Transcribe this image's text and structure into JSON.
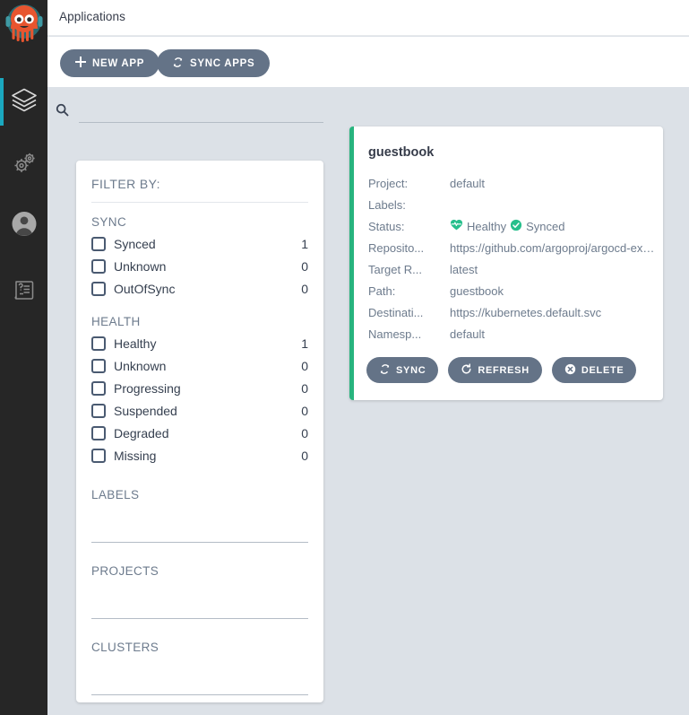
{
  "app": {
    "logo_icon": "argo-octopus-logo"
  },
  "sidebar": {
    "items": [
      {
        "icon": "layers-icon",
        "name": "applications",
        "active": true
      },
      {
        "icon": "gears-icon",
        "name": "settings",
        "active": false
      },
      {
        "icon": "user-icon",
        "name": "user-info",
        "active": false
      },
      {
        "icon": "documentation-icon",
        "name": "documentation",
        "active": false
      }
    ]
  },
  "header": {
    "title": "Applications"
  },
  "toolbar": {
    "new_app_label": "NEW APP",
    "new_app_icon": "plus-icon",
    "sync_apps_label": "SYNC APPS",
    "sync_apps_icon": "sync-icon"
  },
  "search": {
    "icon": "search-icon",
    "value": "",
    "placeholder": ""
  },
  "filters": {
    "title": "FILTER BY:",
    "groups": [
      {
        "heading": "SYNC",
        "options": [
          {
            "label": "Synced",
            "count": "1",
            "checked": false
          },
          {
            "label": "Unknown",
            "count": "0",
            "checked": false
          },
          {
            "label": "OutOfSync",
            "count": "0",
            "checked": false
          }
        ]
      },
      {
        "heading": "HEALTH",
        "options": [
          {
            "label": "Healthy",
            "count": "1",
            "checked": false
          },
          {
            "label": "Unknown",
            "count": "0",
            "checked": false
          },
          {
            "label": "Progressing",
            "count": "0",
            "checked": false
          },
          {
            "label": "Suspended",
            "count": "0",
            "checked": false
          },
          {
            "label": "Degraded",
            "count": "0",
            "checked": false
          },
          {
            "label": "Missing",
            "count": "0",
            "checked": false
          }
        ]
      }
    ],
    "text_groups": [
      {
        "heading": "LABELS",
        "value": "",
        "placeholder": ""
      },
      {
        "heading": "PROJECTS",
        "value": "",
        "placeholder": ""
      },
      {
        "heading": "CLUSTERS",
        "value": "",
        "placeholder": ""
      }
    ]
  },
  "application_card": {
    "name": "guestbook",
    "accent_color": "#28b47e",
    "rows": [
      {
        "key": "Project:",
        "value": "default"
      },
      {
        "key": "Labels:",
        "value": ""
      },
      {
        "key": "Repository:",
        "key_display": "Reposito...",
        "value": "https://github.com/argoproj/argocd-exa..."
      },
      {
        "key": "Target Revision:",
        "key_display": "Target R...",
        "value": "latest"
      },
      {
        "key": "Path:",
        "key_display": "Path:",
        "value": "guestbook"
      },
      {
        "key": "Destination:",
        "key_display": "Destinati...",
        "value": "https://kubernetes.default.svc"
      },
      {
        "key": "Namespace:",
        "key_display": "Namesp...",
        "value": "default"
      }
    ],
    "status": {
      "key": "Status:",
      "health_icon": "heartbeat-icon",
      "health_label": "Healthy",
      "sync_icon": "check-circle-icon",
      "sync_label": "Synced"
    },
    "actions": [
      {
        "label": "SYNC",
        "icon": "sync-icon"
      },
      {
        "label": "REFRESH",
        "icon": "refresh-icon"
      },
      {
        "label": "DELETE",
        "icon": "delete-circle-icon"
      }
    ]
  }
}
